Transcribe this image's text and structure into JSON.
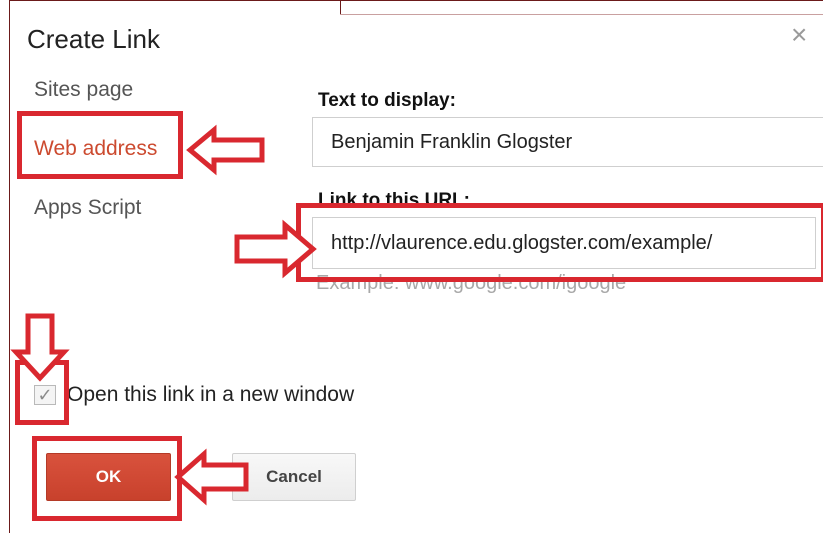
{
  "dialog": {
    "title": "Create Link",
    "close_symbol": "×"
  },
  "sidebar": {
    "items": [
      {
        "label": "Sites page",
        "selected": false
      },
      {
        "label": "Web address",
        "selected": true
      },
      {
        "label": "Apps Script",
        "selected": false
      }
    ]
  },
  "form": {
    "text_label": "Text to display:",
    "text_value": "Benjamin Franklin Glogster",
    "url_label": "Link to this URL:",
    "url_value": "http://vlaurence.edu.glogster.com/example/",
    "example_hint": "Example: www.google.com/igoogle",
    "new_window_label": "Open this link in a new window",
    "new_window_checked": true,
    "check_symbol": "✓"
  },
  "buttons": {
    "ok_label": "OK",
    "cancel_label": "Cancel"
  },
  "annotations": {
    "color": "#d9282f",
    "arrow_icons": [
      "left-arrow-icon",
      "right-arrow-icon",
      "down-arrow-icon",
      "left-arrow-icon"
    ]
  }
}
